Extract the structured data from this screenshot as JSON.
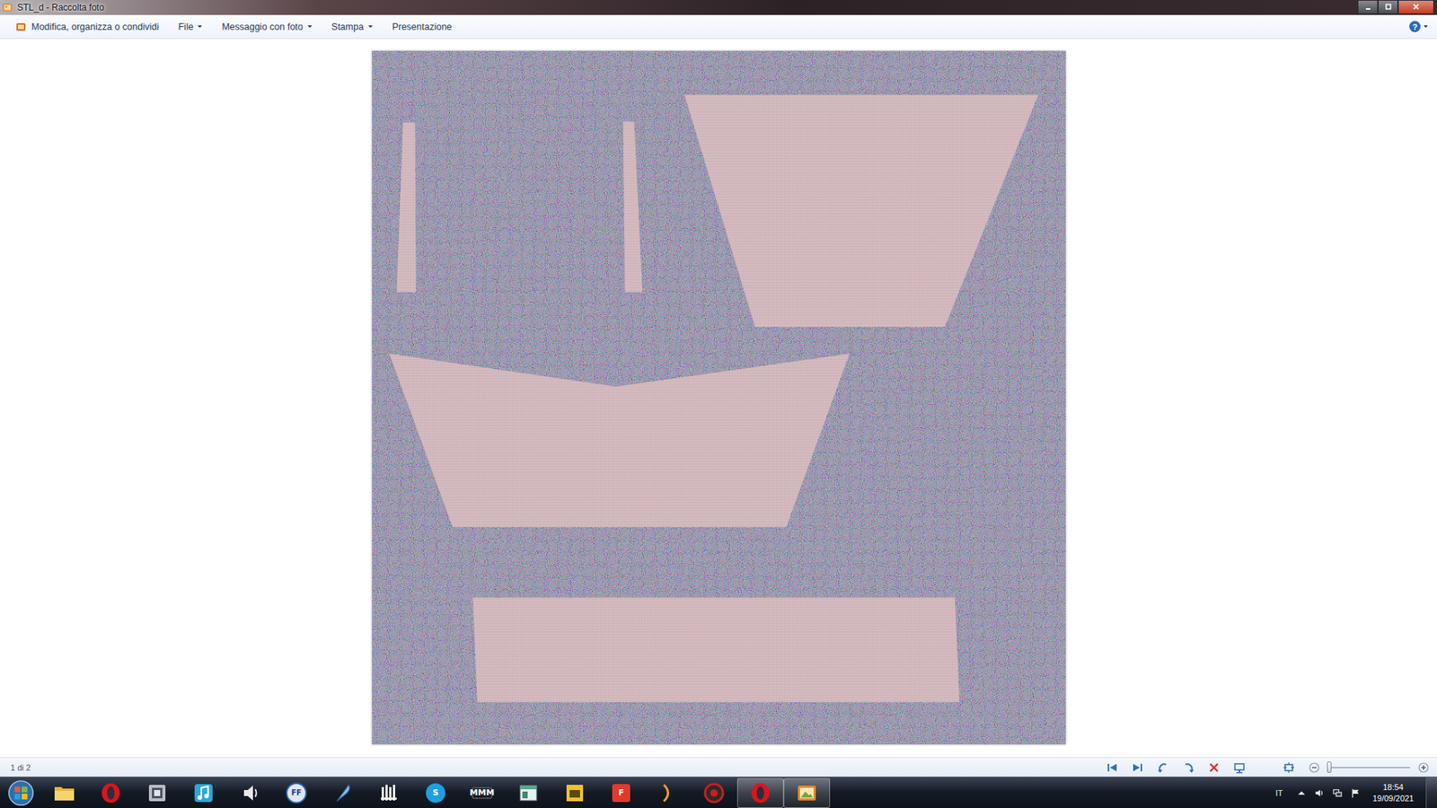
{
  "window": {
    "title": "STL_d - Raccolta foto"
  },
  "menu": [
    {
      "label": "Modifica, organizza o condividi",
      "dropdown": false,
      "kind": "organize"
    },
    {
      "label": "File",
      "dropdown": true,
      "kind": "plain"
    },
    {
      "label": "Messaggio con foto",
      "dropdown": true,
      "kind": "plain"
    },
    {
      "label": "Stampa",
      "dropdown": true,
      "kind": "plain"
    },
    {
      "label": "Presentazione",
      "dropdown": false,
      "kind": "plain"
    }
  ],
  "help": {
    "label": "?",
    "dropdown": true
  },
  "status_bar": {
    "position": "1 di 2",
    "zoom": {
      "level": 0.0
    }
  },
  "taskbar": {
    "apps": [
      {
        "kind": "folder",
        "label": "",
        "running": false
      },
      {
        "kind": "opera",
        "label": "",
        "running": false
      },
      {
        "kind": "media",
        "label": "",
        "running": false
      },
      {
        "kind": "music",
        "label": "",
        "running": false
      },
      {
        "kind": "speaker",
        "label": "",
        "running": false
      },
      {
        "kind": "ff",
        "label": "FF",
        "running": false
      },
      {
        "kind": "feather",
        "label": "",
        "running": false
      },
      {
        "kind": "bars",
        "label": "",
        "running": false
      },
      {
        "kind": "skype",
        "label": "S",
        "running": false
      },
      {
        "kind": "mmm",
        "label": "MMM",
        "running": false
      },
      {
        "kind": "window",
        "label": "",
        "running": false
      },
      {
        "kind": "yellow",
        "label": "",
        "running": false
      },
      {
        "kind": "foxit",
        "label": "F",
        "running": false
      },
      {
        "kind": "arrow",
        "label": "",
        "running": false
      },
      {
        "kind": "gear",
        "label": "",
        "running": false
      },
      {
        "kind": "opera",
        "label": "",
        "running": true
      },
      {
        "kind": "gallery",
        "label": "",
        "running": true
      }
    ],
    "tray": {
      "language": "IT",
      "time": "18:54",
      "date": "19/09/2021"
    }
  }
}
